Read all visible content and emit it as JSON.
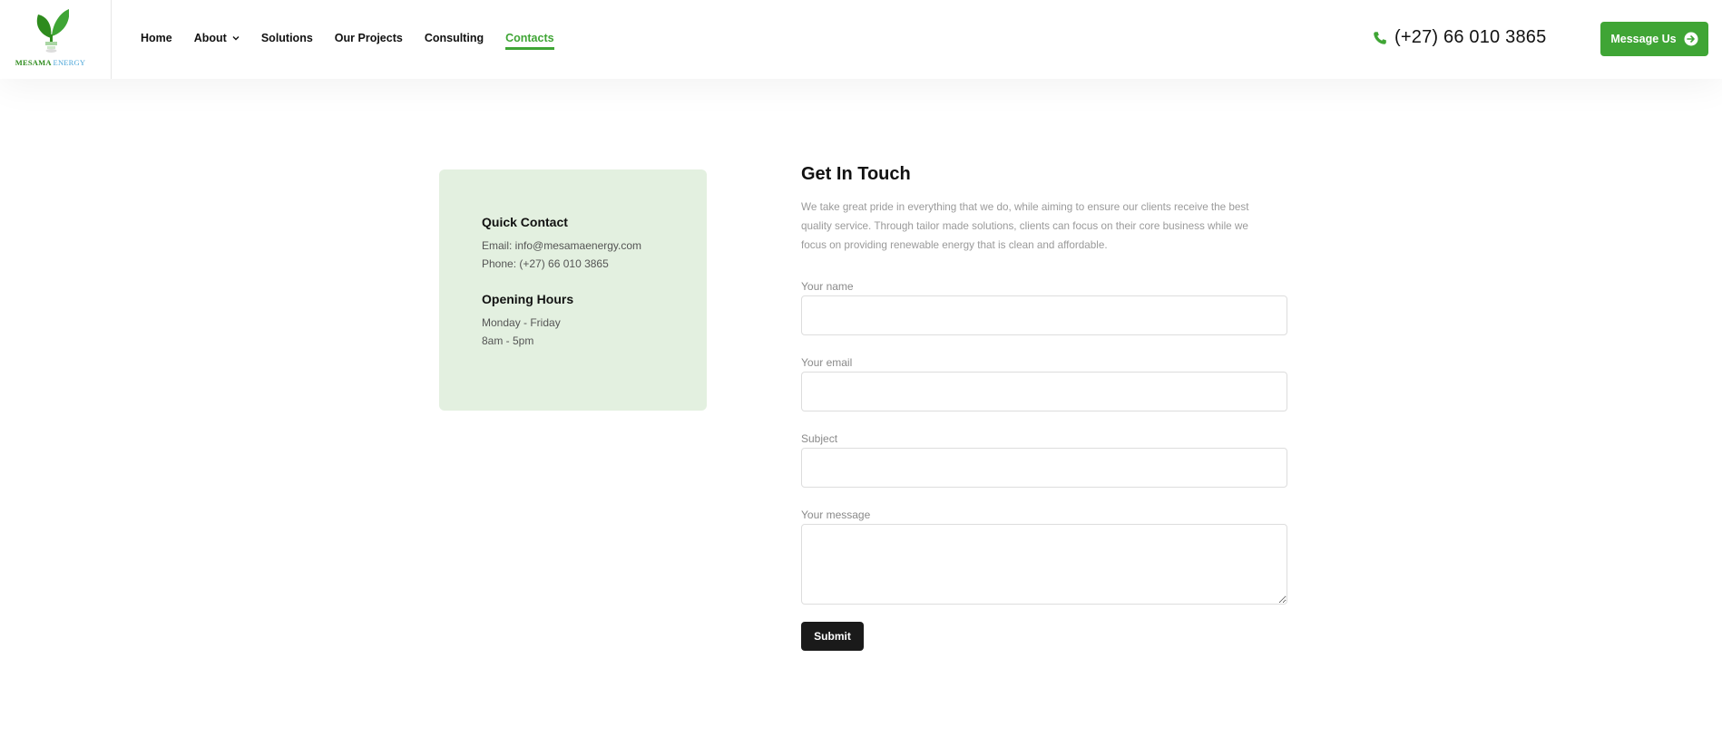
{
  "logo": {
    "word1": "MESAMA",
    "word2": "ENERGY",
    "icon": "leaf-logo-icon"
  },
  "nav": {
    "items": [
      {
        "label": "Home"
      },
      {
        "label": "About",
        "has_dropdown": true
      },
      {
        "label": "Solutions"
      },
      {
        "label": "Our Projects"
      },
      {
        "label": "Consulting"
      },
      {
        "label": "Contacts",
        "active": true
      }
    ]
  },
  "header": {
    "phone": "(+27) 66 010 3865",
    "phone_icon": "phone-icon",
    "message_button": "Message Us",
    "message_button_icon": "arrow-right-circle-icon"
  },
  "contact_card": {
    "quick_contact_title": "Quick Contact",
    "email_line": "Email: info@mesamaenergy.com",
    "phone_line": "Phone: (+27) 66 010 3865",
    "hours_title": "Opening Hours",
    "hours_days": "Monday - Friday",
    "hours_time": "8am - 5pm"
  },
  "form": {
    "title": "Get In Touch",
    "description_lines": [
      "We take great pride in everything that we do, while aiming to ensure our clients receive the best",
      "quality service. Through tailor made solutions, clients can focus on their core business while we",
      "focus on providing renewable energy that is clean and affordable."
    ],
    "name_label": "Your name",
    "name_value": "",
    "email_label": "Your email",
    "email_value": "",
    "subject_label": "Subject",
    "subject_value": "",
    "message_label": "Your message",
    "message_value": "",
    "submit_label": "Submit"
  },
  "colors": {
    "brand_green": "#3fa535",
    "card_bg": "#e3f0e0",
    "submit_bg": "#1a1a1a"
  }
}
